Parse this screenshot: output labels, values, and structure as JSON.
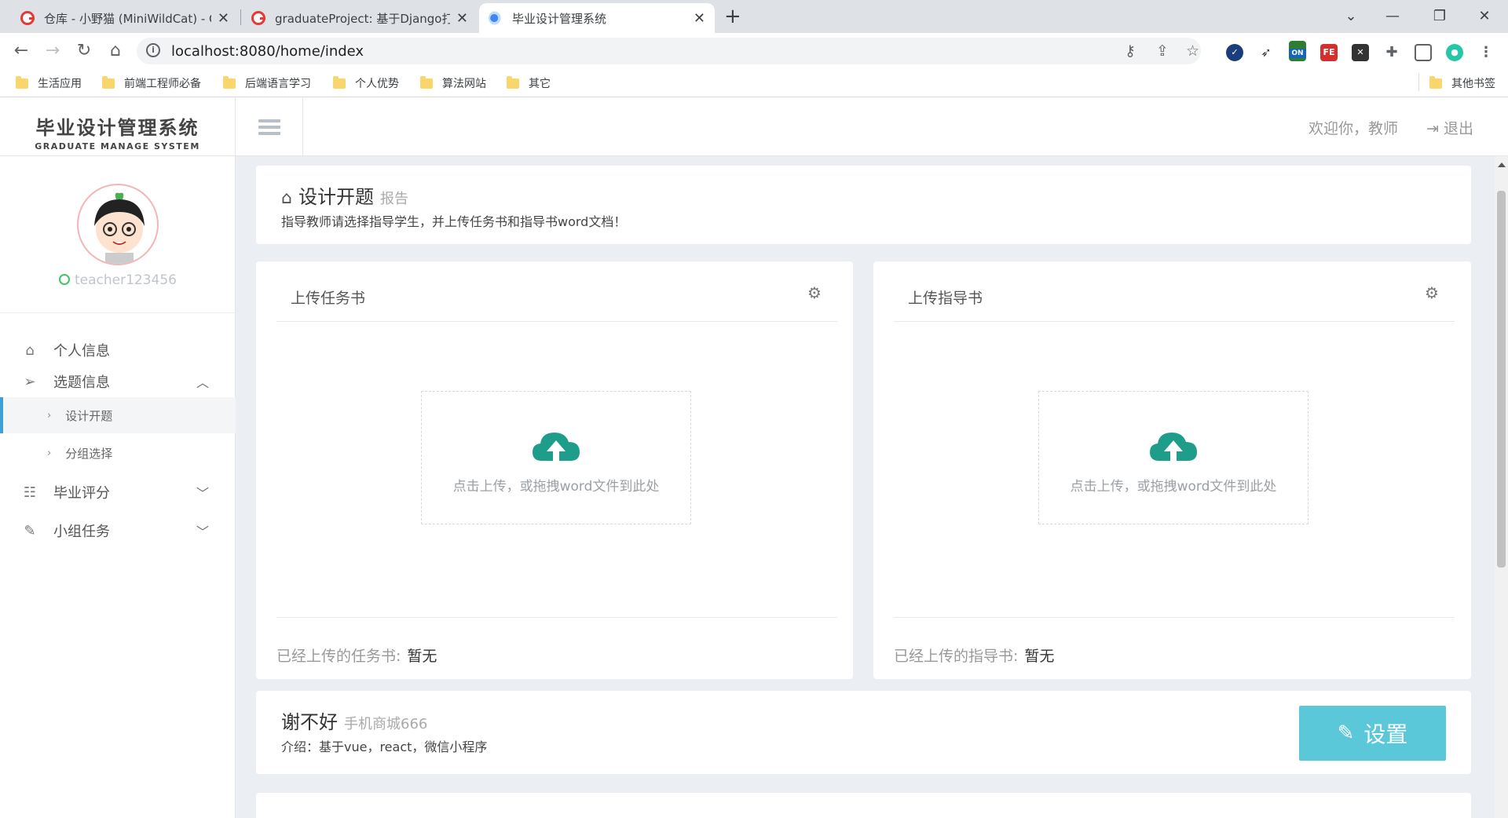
{
  "browser": {
    "tabs": [
      {
        "label": "仓库 - 小野猫 (MiniWildCat) - G"
      },
      {
        "label": "graduateProject: 基于Django打"
      },
      {
        "label": "毕业设计管理系统"
      }
    ],
    "url": "localhost:8080/home/index",
    "ext_on_label": "ON",
    "ext_fe_label": "FE",
    "bookmarks": [
      "生活应用",
      "前端工程师必备",
      "后端语言学习",
      "个人优势",
      "算法网站",
      "其它"
    ],
    "other_bookmarks": "其他书签"
  },
  "brand": {
    "cn": "毕业设计管理系统",
    "en": "GRADUATE MANAGE SYSTEM"
  },
  "header": {
    "welcome": "欢迎你，教师",
    "logout": "退出"
  },
  "user": {
    "name": "teacher123456"
  },
  "sidebar": {
    "items": [
      {
        "label": "个人信息"
      },
      {
        "label": "选题信息"
      },
      {
        "label": "毕业评分"
      },
      {
        "label": "小组任务"
      }
    ],
    "subitems": [
      {
        "label": "设计开题"
      },
      {
        "label": "分组选择"
      }
    ]
  },
  "page": {
    "title": "设计开题",
    "subtitle": "报告",
    "description": "指导教师请选择指导学生，并上传任务书和指导书word文档！"
  },
  "cards": [
    {
      "title": "上传任务书",
      "drop_text": "点击上传，或拖拽word文件到此处",
      "uploaded_label": "已经上传的任务书:",
      "uploaded_value": "暂无"
    },
    {
      "title": "上传指导书",
      "drop_text": "点击上传，或拖拽word文件到此处",
      "uploaded_label": "已经上传的指导书:",
      "uploaded_value": "暂无"
    }
  ],
  "project": {
    "title": "谢不好",
    "subtitle": "手机商城666",
    "description": "介绍：基于vue，react，微信小程序",
    "button": "设置"
  },
  "colors": {
    "accent": "#5bc8da",
    "upload_icon": "#1e9e8a",
    "active_bar": "#3ea0d4"
  }
}
